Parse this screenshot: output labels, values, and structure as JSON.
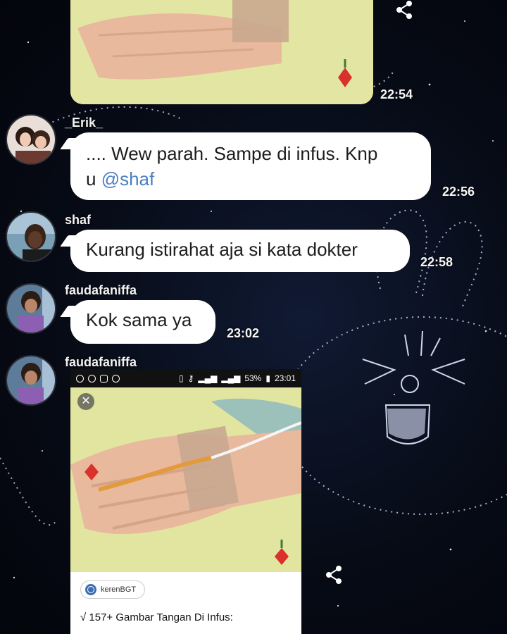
{
  "messages": [
    {
      "type": "image",
      "time": "22:54"
    },
    {
      "type": "text",
      "sender": "_Erik_",
      "text_before": ".... Wew parah. Sampe di infus. Knp",
      "text_line2_prefix": "u ",
      "mention": "@shaf",
      "time": "22:56"
    },
    {
      "type": "text",
      "sender": "shaf",
      "text": "Kurang istirahat aja si kata dokter",
      "time": "22:58"
    },
    {
      "type": "text",
      "sender": "faudafaniffa",
      "text": "Kok sama ya",
      "time": "23:02"
    },
    {
      "type": "image",
      "sender": "faudafaniffa",
      "status_bar": {
        "battery": "53%",
        "clock": "23:01"
      },
      "close_label": "✕",
      "source": "kerenBGT",
      "result_title": "√ 157+ Gambar Tangan Di Infus:"
    }
  ],
  "icons": {
    "share": "share-icon",
    "close": "close-icon",
    "globe": "globe-icon"
  },
  "colors": {
    "background": "#070b16",
    "bubble": "#ffffff",
    "mention": "#4a7fbf"
  }
}
